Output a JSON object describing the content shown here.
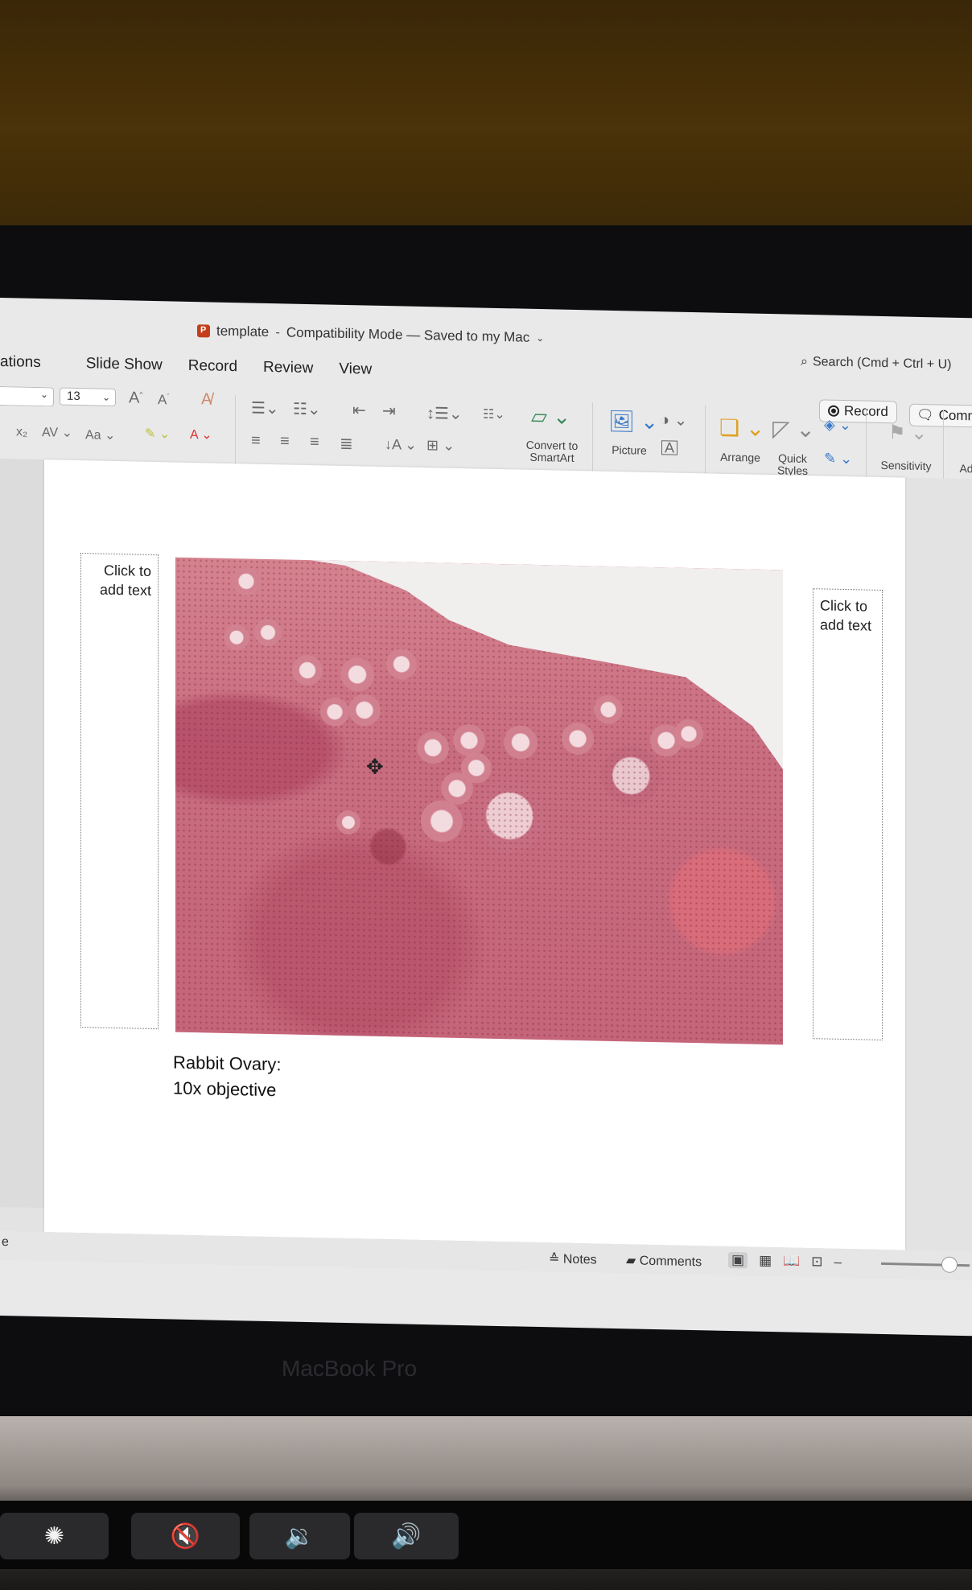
{
  "window": {
    "doc_name": "template",
    "mode": "Compatibility Mode — Saved to my Mac",
    "search_placeholder": "Search (Cmd + Ctrl + U)"
  },
  "tabs": [
    "ations",
    "Slide Show",
    "Record",
    "Review",
    "View"
  ],
  "toolbar": {
    "record_label": "Record",
    "comments_label": "Comm",
    "font_size": "13",
    "convert_smartart": "Convert to SmartArt",
    "picture_label": "Picture",
    "arrange_label": "Arrange",
    "quick_styles_label": "Quick Styles",
    "sensitivity_label": "Sensitivity",
    "add_label": "Ad"
  },
  "slide": {
    "left_placeholder": "Click to add text",
    "right_placeholder": "Click to add text",
    "caption_line1": "Rabbit Ovary:",
    "caption_line2": "10x objective"
  },
  "statusbar": {
    "left_text": "e",
    "notes_label": "Notes",
    "comments_label": "Comments"
  },
  "device": {
    "label": "MacBook Pro"
  }
}
